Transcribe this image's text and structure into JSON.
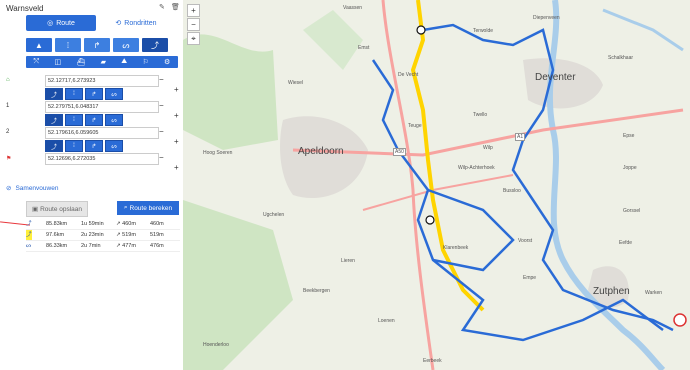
{
  "sidebar": {
    "title": "Warnsveld",
    "tab_route": "Route",
    "tab_round": "Rondritten",
    "waypoints": [
      {
        "num": "",
        "coord": "52.12717,6.273923"
      },
      {
        "num": "1",
        "coord": "52.279751,6.048317"
      },
      {
        "num": "2",
        "coord": "52.179616,6.059605"
      },
      {
        "num": "",
        "coord": "52.12696,6.272035"
      }
    ],
    "collapse": "Samenvouwen",
    "save": "Route opslaan",
    "calc": "Route bereken",
    "results": [
      {
        "dist": "85.83km",
        "time": "1u 59min",
        "up": "↗ 460m",
        "down": "460m"
      },
      {
        "dist": "97.6km",
        "time": "2u 23min",
        "up": "↗ 519m",
        "down": "519m"
      },
      {
        "dist": "86.33km",
        "time": "2u 7min",
        "up": "↗ 477m",
        "down": "476m"
      }
    ]
  },
  "map": {
    "cities": [
      "Apeldoorn",
      "Deventer",
      "Zutphen"
    ],
    "towns": [
      "Vaassen",
      "Terwolde",
      "Diepenveen",
      "Schalkhaar",
      "Epse",
      "Joppe",
      "Twello",
      "Wilp-Achterhoek",
      "Bussloo",
      "Voorst",
      "Klarenbeek",
      "Emst",
      "De Vecht",
      "Teuge",
      "Wiesel",
      "Hoog Soeren",
      "Ugchelen",
      "Beekbergen",
      "Lieren",
      "Loenen",
      "Hoenderloo",
      "Eerbeek",
      "Eefde",
      "Warken",
      "Gorssel",
      "Empe",
      "Wilp"
    ],
    "roads": [
      "A50",
      "A1"
    ]
  }
}
